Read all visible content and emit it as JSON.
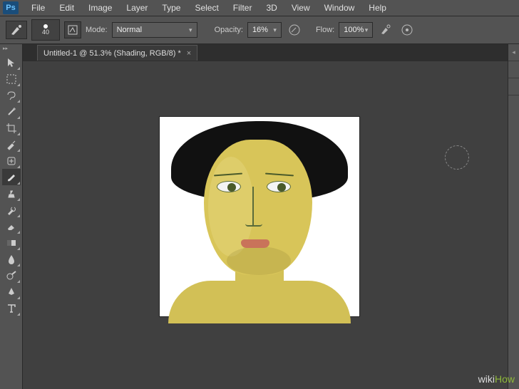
{
  "app": {
    "logo": "Ps"
  },
  "menu": [
    "File",
    "Edit",
    "Image",
    "Layer",
    "Type",
    "Select",
    "Filter",
    "3D",
    "View",
    "Window",
    "Help"
  ],
  "options": {
    "brush_size": "40",
    "mode_label": "Mode:",
    "mode_value": "Normal",
    "opacity_label": "Opacity:",
    "opacity_value": "16%",
    "flow_label": "Flow:",
    "flow_value": "100%"
  },
  "document": {
    "tab_label": "Untitled-1 @ 51.3% (Shading, RGB/8) *"
  },
  "watermark": {
    "wiki": "wiki",
    "how": "How"
  }
}
